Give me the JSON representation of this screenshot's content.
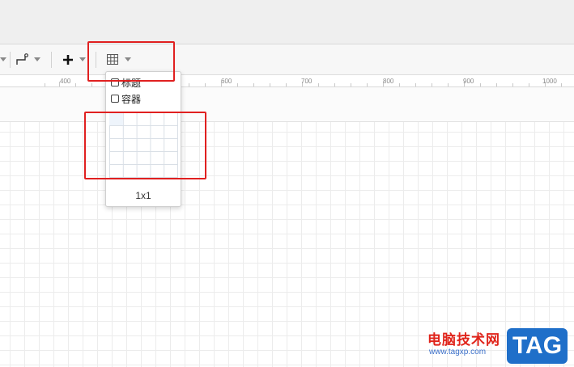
{
  "ruler": {
    "labels": [
      "400",
      "600",
      "700",
      "800",
      "900",
      "1000"
    ]
  },
  "toolbar": {
    "connector_icon": "waypoint-connector-icon",
    "insert_icon": "plus-icon",
    "table_icon": "table-grid-icon"
  },
  "table_dropdown": {
    "option_title": "标题",
    "option_container": "容器",
    "size_label": "1x1",
    "grid_columns": 5,
    "grid_rows": 5
  },
  "watermark": {
    "site_name": "电脑技术网",
    "url": "www.tagxp.com",
    "tag": "TAG"
  },
  "colors": {
    "highlight": "#e02020",
    "grid_line": "#ececec",
    "watermark_red": "#e0241b",
    "watermark_blue": "#1f6fc9"
  }
}
